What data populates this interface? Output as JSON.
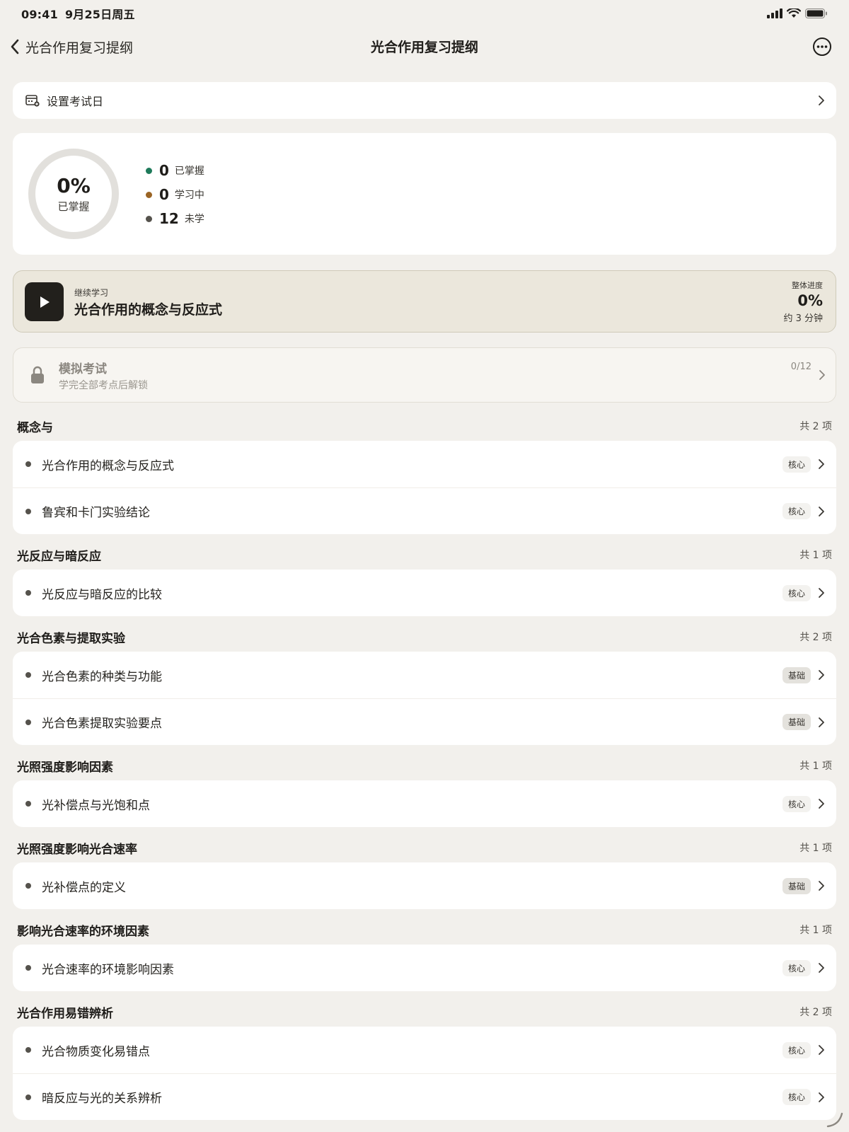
{
  "status_bar": {
    "time": "09:41",
    "date": "9月25日周五"
  },
  "nav": {
    "back_label": "光合作用复习提纲",
    "title": "光合作用复习提纲"
  },
  "exam_date": {
    "label": "设置考试日"
  },
  "progress": {
    "percent_text": "0%",
    "percent_value": 0,
    "ring_label": "已掌握",
    "legend": [
      {
        "count": "0",
        "label": "已掌握",
        "color": "#1e7a5a"
      },
      {
        "count": "0",
        "label": "学习中",
        "color": "#9a6424"
      },
      {
        "count": "12",
        "label": "未学",
        "color": "#55524c"
      }
    ]
  },
  "continue_card": {
    "kicker": "继续学习",
    "title": "光合作用的概念与反应式",
    "progress_label": "整体进度",
    "progress_value": "0%",
    "time_estimate": "约 3 分钟"
  },
  "mock_exam": {
    "title": "模拟考试",
    "subtitle": "学完全部考点后解锁",
    "count": "0/12"
  },
  "sections": [
    {
      "name": "概念与",
      "count": "共 2 项",
      "items": [
        {
          "label": "光合作用的概念与反应式",
          "tag": "核心",
          "tag_type": "core"
        },
        {
          "label": "鲁宾和卡门实验结论",
          "tag": "核心",
          "tag_type": "core"
        }
      ]
    },
    {
      "name": "光反应与暗反应",
      "count": "共 1 项",
      "items": [
        {
          "label": "光反应与暗反应的比较",
          "tag": "核心",
          "tag_type": "core"
        }
      ]
    },
    {
      "name": "光合色素与提取实验",
      "count": "共 2 项",
      "items": [
        {
          "label": "光合色素的种类与功能",
          "tag": "基础",
          "tag_type": "basic"
        },
        {
          "label": "光合色素提取实验要点",
          "tag": "基础",
          "tag_type": "basic"
        }
      ]
    },
    {
      "name": "光照强度影响因素",
      "count": "共 1 项",
      "items": [
        {
          "label": "光补偿点与光饱和点",
          "tag": "核心",
          "tag_type": "core"
        }
      ]
    },
    {
      "name": "光照强度影响光合速率",
      "count": "共 1 项",
      "items": [
        {
          "label": "光补偿点的定义",
          "tag": "基础",
          "tag_type": "basic"
        }
      ]
    },
    {
      "name": "影响光合速率的环境因素",
      "count": "共 1 项",
      "items": [
        {
          "label": "光合速率的环境影响因素",
          "tag": "核心",
          "tag_type": "core"
        }
      ]
    },
    {
      "name": "光合作用易错辨析",
      "count": "共 2 项",
      "items": [
        {
          "label": "光合物质变化易错点",
          "tag": "核心",
          "tag_type": "core"
        },
        {
          "label": "暗反应与光的关系辨析",
          "tag": "核心",
          "tag_type": "core"
        }
      ]
    }
  ]
}
